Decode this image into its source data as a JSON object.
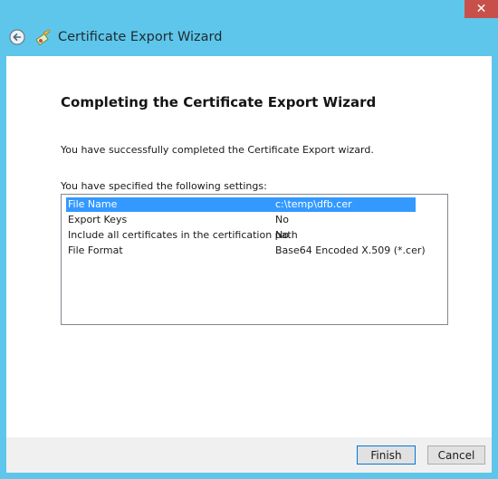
{
  "window": {
    "close_label": "✕"
  },
  "header": {
    "title": "Certificate Export Wizard",
    "back_icon": "back-arrow-icon",
    "wizard_icon": "certificate-icon"
  },
  "main": {
    "heading": "Completing the Certificate Export Wizard",
    "description": "You have successfully completed the Certificate Export wizard.",
    "settings_label": "You have specified the following settings:",
    "settings": [
      {
        "name": "File Name",
        "value": "c:\\temp\\dfb.cer"
      },
      {
        "name": "Export Keys",
        "value": "No"
      },
      {
        "name": "Include all certificates in the certification path",
        "value": "No"
      },
      {
        "name": "File Format",
        "value": "Base64 Encoded X.509 (*.cer)"
      }
    ]
  },
  "footer": {
    "finish_label": "Finish",
    "cancel_label": "Cancel"
  },
  "colors": {
    "titlebar": "#5ec6ea",
    "selection": "#3399ff",
    "close": "#c7504b"
  }
}
